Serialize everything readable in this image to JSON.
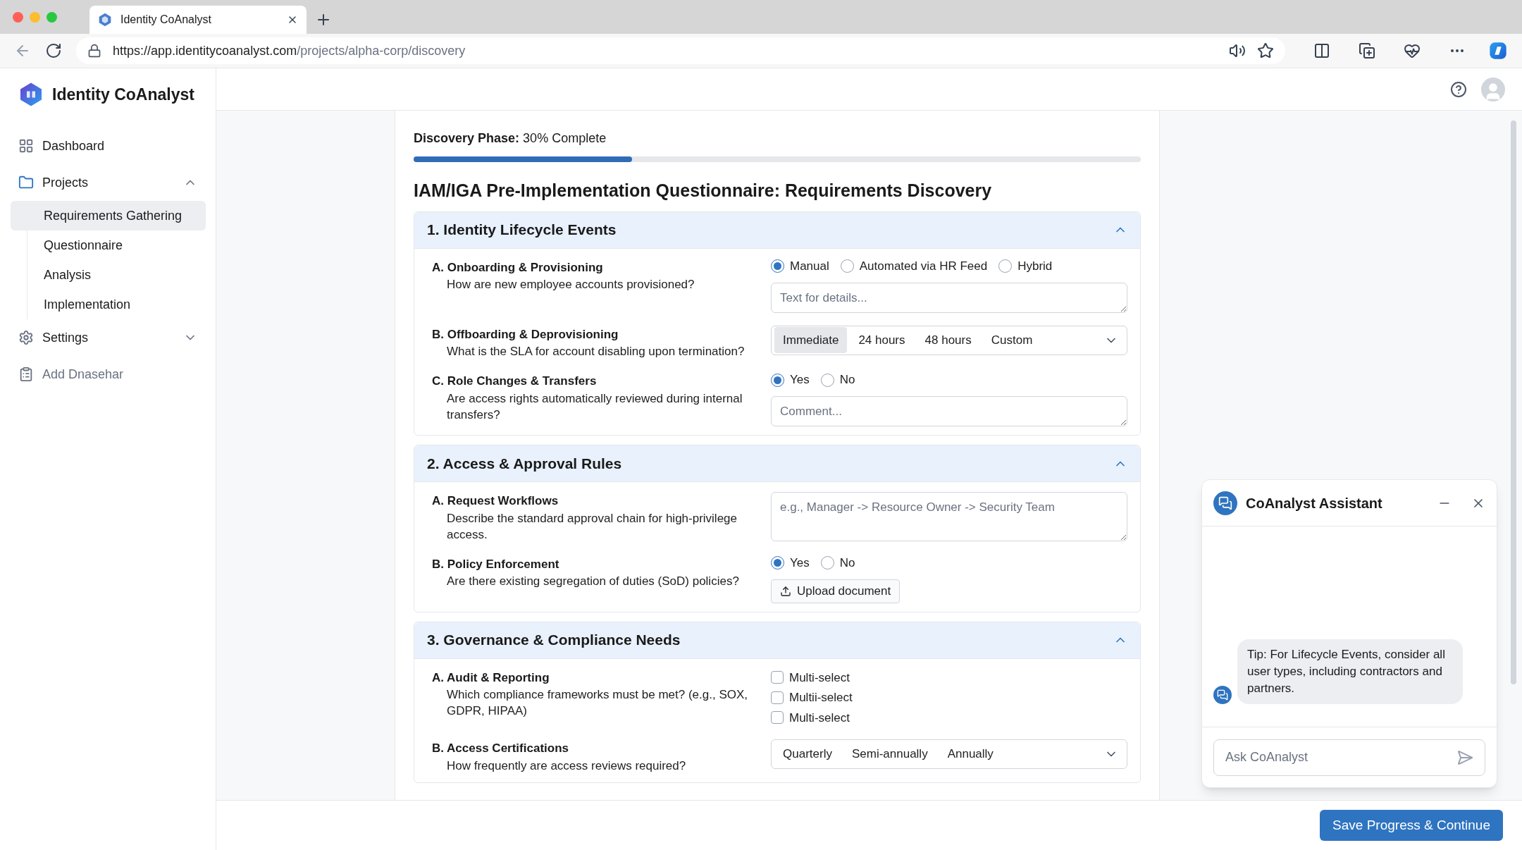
{
  "browser": {
    "tab_title": "Identity CoAnalyst",
    "url_host": "https://app.identitycoanalyst.com",
    "url_path": "/projects/alpha-corp/discovery"
  },
  "brand": "Identity CoAnalyst",
  "sidebar": {
    "items": [
      {
        "label": "Dashboard",
        "kind": "link",
        "disabled": false
      },
      {
        "label": "Projects",
        "kind": "group",
        "disabled": false,
        "expanded": true,
        "children": [
          {
            "label": "Requirements Gathering",
            "selected": true
          },
          {
            "label": "Questionnaire",
            "selected": false
          },
          {
            "label": "Analysis",
            "selected": false
          },
          {
            "label": "Implementation",
            "selected": false
          }
        ]
      },
      {
        "label": "Settings",
        "kind": "group",
        "disabled": false,
        "expanded": false
      },
      {
        "label": "Add Dnasehar",
        "kind": "link",
        "disabled": true
      }
    ]
  },
  "progress": {
    "label": "Discovery Phase:",
    "value": "30% Complete",
    "level": 0.3
  },
  "title": "IAM/IGA Pre-Implementation Questionnaire: Requirements Discovery",
  "sections": [
    {
      "title": "1. Identity Lifecycle Events",
      "expanded": true,
      "questions": [
        {
          "label": "A. Onboarding & Provisioning",
          "description": "How are new employee accounts provisioned?",
          "controls": [
            {
              "kind": "radio",
              "options": [
                {
                  "label": "Manual",
                  "selected": true
                },
                {
                  "label": "Automated via HR Feed",
                  "selected": false
                },
                {
                  "label": "Hybrid",
                  "selected": false
                }
              ]
            },
            {
              "kind": "textarea",
              "placeholder": "Text for details..."
            }
          ]
        },
        {
          "label": "B. Offboarding & Deprovisioning",
          "description": "What is the SLA for account disabling upon termination?",
          "controls": [
            {
              "kind": "select",
              "options": [
                {
                  "label": "Immediate",
                  "selected": true
                },
                {
                  "label": "24 hours",
                  "selected": false
                },
                {
                  "label": "48 hours",
                  "selected": false
                },
                {
                  "label": "Custom",
                  "selected": false
                }
              ]
            }
          ]
        },
        {
          "label": "C. Role Changes & Transfers",
          "description": "Are access rights automatically reviewed during internal transfers?",
          "controls": [
            {
              "kind": "radio",
              "options": [
                {
                  "label": "Yes",
                  "selected": true
                },
                {
                  "label": "No",
                  "selected": false
                }
              ]
            },
            {
              "kind": "textarea",
              "placeholder": "Comment..."
            }
          ]
        }
      ]
    },
    {
      "title": "2. Access & Approval Rules",
      "expanded": true,
      "questions": [
        {
          "label": "A. Request Workflows",
          "description": "Describe the standard approval chain for high-privilege access.",
          "controls": [
            {
              "kind": "textarea",
              "placeholder": "e.g., Manager -> Resource Owner -> Security Team"
            }
          ]
        },
        {
          "label": "B. Policy Enforcement",
          "description": "Are there existing segregation of duties (SoD) policies?",
          "controls": [
            {
              "kind": "radio",
              "options": [
                {
                  "label": "Yes",
                  "selected": true
                },
                {
                  "label": "No",
                  "selected": false
                }
              ]
            },
            {
              "kind": "upload",
              "label": "Upload document"
            }
          ]
        }
      ]
    },
    {
      "title": "3. Governance & Compliance Needs",
      "expanded": true,
      "questions": [
        {
          "label": "A. Audit & Reporting",
          "description": "Which compliance frameworks must be met? (e.g., SOX, GDPR, HIPAA)",
          "controls": [
            {
              "kind": "checkboxes",
              "options": [
                {
                  "label": "Multi-select",
                  "checked": false
                },
                {
                  "label": "Multii-select",
                  "checked": false
                },
                {
                  "label": "Multi-select",
                  "checked": false
                }
              ]
            }
          ]
        },
        {
          "label": "B. Access Certifications",
          "description": "How frequently are access reviews required?",
          "controls": [
            {
              "kind": "select",
              "options": [
                {
                  "label": "Quarterly",
                  "selected": false
                },
                {
                  "label": "Semi-annually",
                  "selected": false
                },
                {
                  "label": "Annually",
                  "selected": false
                }
              ]
            }
          ]
        }
      ]
    }
  ],
  "chat": {
    "title": "CoAnalyst Assistant",
    "messages": [
      {
        "text": "Tip: For Lifecycle Events, consider all user types, including contractors and partners."
      }
    ],
    "placeholder": "Ask CoAnalyst"
  },
  "footer": {
    "button": "Save Progress & Continue"
  }
}
